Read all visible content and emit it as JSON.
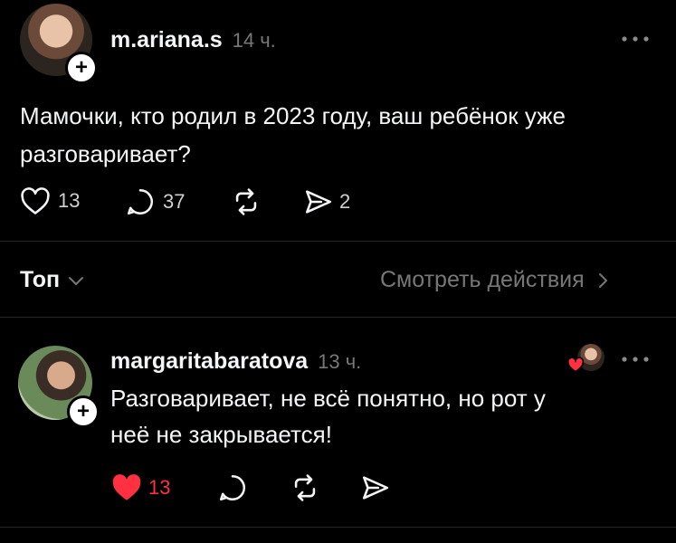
{
  "post": {
    "username": "m.ariana.s",
    "time": "14 ч.",
    "text_line1": "Мамочки, кто родил в 2023 году, ваш ребёнок уже",
    "text_line2": "разговаривает?",
    "likes": "13",
    "comments": "37",
    "shares": "2"
  },
  "sort": {
    "label": "Топ",
    "activity_link": "Смотреть действия"
  },
  "reply": {
    "username": "margaritabaratova",
    "time": "13 ч.",
    "text_line1": "Разговаривает, не всё понятно, но рот у",
    "text_line2": "неё не закрывается!",
    "likes": "13"
  },
  "colors": {
    "background": "#000000",
    "text": "#f3f5f7",
    "muted": "#777777",
    "like_red": "#ff3040"
  },
  "icons": [
    "heart-icon",
    "comment-icon",
    "repost-icon",
    "send-icon",
    "more-icon",
    "plus-icon",
    "chevron-down-icon",
    "chevron-right-icon"
  ]
}
